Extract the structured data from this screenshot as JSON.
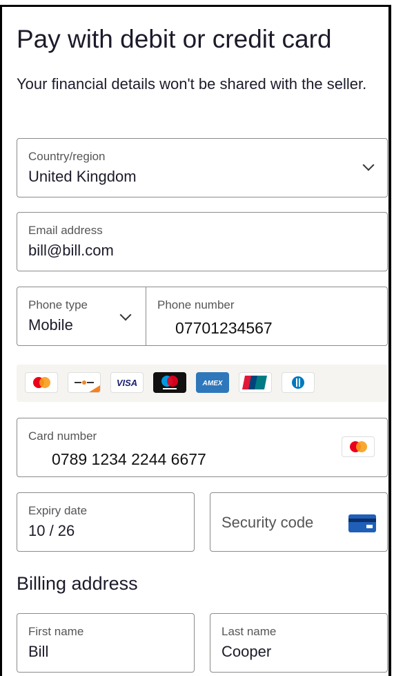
{
  "page": {
    "title": "Pay with debit or credit card",
    "subtitle": "Your financial details won't be shared with the seller."
  },
  "country": {
    "label": "Country/region",
    "value": "United Kingdom"
  },
  "email": {
    "label": "Email address",
    "value": "bill@bill.com"
  },
  "phone_type": {
    "label": "Phone type",
    "value": "Mobile"
  },
  "phone_number": {
    "label": "Phone number",
    "value": "07701234567"
  },
  "card_logos": [
    "mastercard",
    "discover",
    "visa",
    "maestro",
    "amex",
    "unionpay",
    "diners"
  ],
  "card_number": {
    "label": "Card number",
    "value": "0789 1234 2244 6677",
    "detected_brand": "mastercard"
  },
  "expiry": {
    "label": "Expiry date",
    "value": "10 / 26"
  },
  "security_code": {
    "placeholder": "Security code",
    "icon": "card-back-icon"
  },
  "billing": {
    "heading": "Billing address",
    "first_name": {
      "label": "First name",
      "value": "Bill"
    },
    "last_name": {
      "label": "Last name",
      "value": "Cooper"
    }
  },
  "colors": {
    "text": "#1b1b2a",
    "border": "#8a8a8a",
    "visa": "#1a1f71",
    "amex": "#2e77bb",
    "mastercard_red": "#eb001b",
    "mastercard_orange": "#f79e1b"
  }
}
